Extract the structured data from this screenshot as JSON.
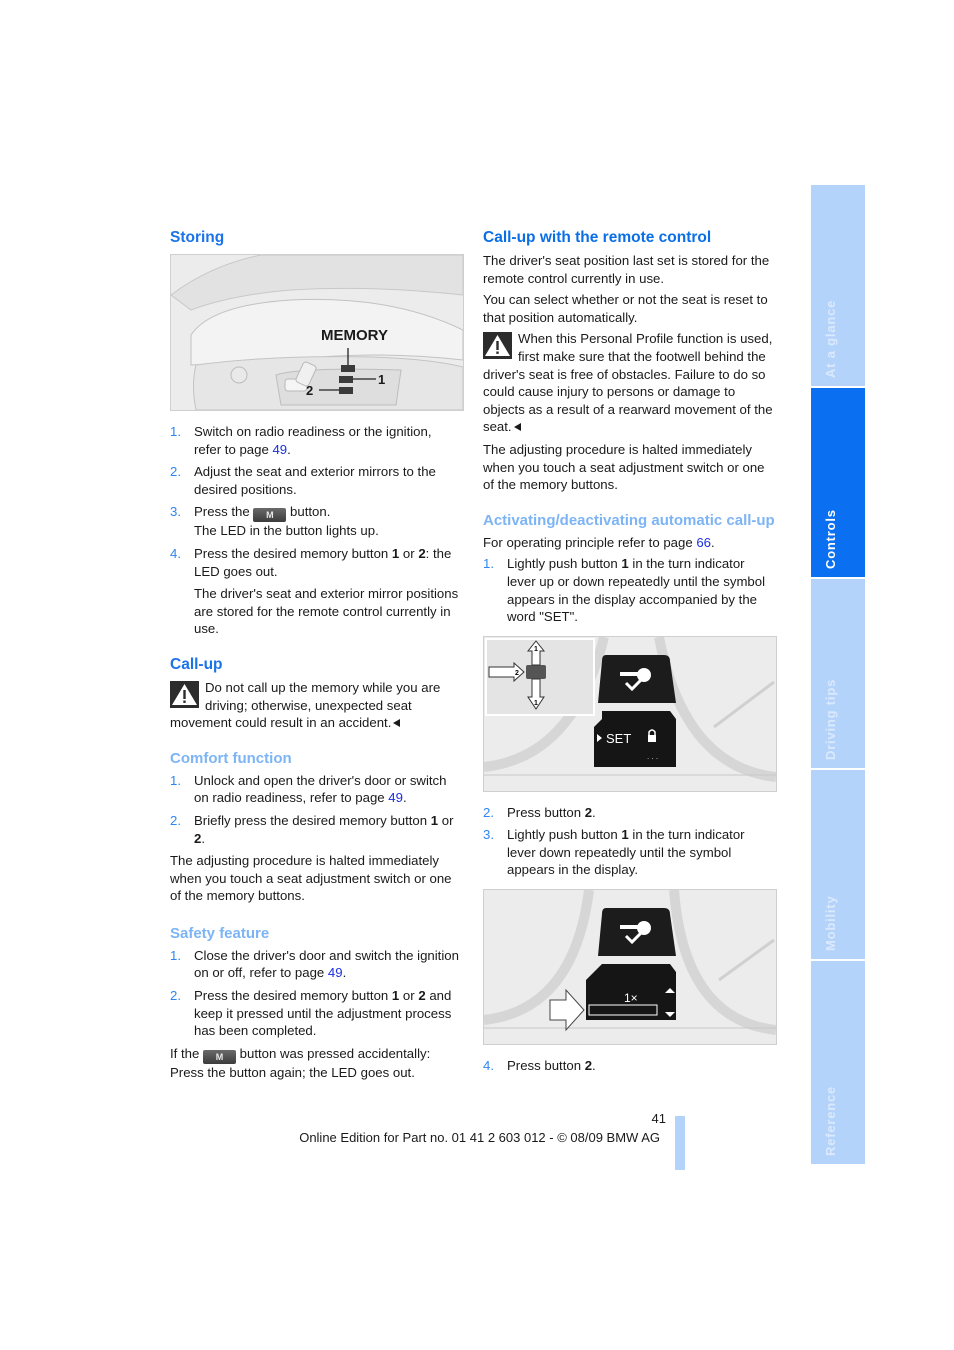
{
  "left": {
    "storing": {
      "heading": "Storing",
      "figure": {
        "label": "MEMORY",
        "callout1": "1",
        "callout2": "2"
      },
      "steps": [
        {
          "num": "1.",
          "pre": "Switch on radio readiness or the ignition, refer to page ",
          "link": "49",
          "post": "."
        },
        {
          "num": "2.",
          "text": "Adjust the seat and exterior mirrors to the desired positions."
        },
        {
          "num": "3.",
          "pre": "Press the ",
          "button": "M",
          "post": " button.",
          "line2": "The LED in the button lights up."
        },
        {
          "num": "4.",
          "pre": "Press the desired memory button ",
          "b1": "1",
          "mid": " or ",
          "b2": "2",
          "post": ": the LED goes out."
        }
      ],
      "note": "The driver's seat and exterior mirror positions are stored for the remote control currently in use."
    },
    "callup": {
      "heading": "Call-up",
      "warning": "Do not call up the memory while you are driving; otherwise, unexpected seat movement could result in an accident."
    },
    "comfort": {
      "heading": "Comfort function",
      "steps": [
        {
          "num": "1.",
          "pre": "Unlock and open the driver's door or switch on radio readiness, refer to page ",
          "link": "49",
          "post": "."
        },
        {
          "num": "2.",
          "pre": "Briefly press the desired memory button ",
          "b1": "1",
          "mid": " or ",
          "b2": "2",
          "post": "."
        }
      ],
      "note": "The adjusting procedure is halted immediately when you touch a seat adjustment switch or one of the memory buttons."
    },
    "safety": {
      "heading": "Safety feature",
      "steps": [
        {
          "num": "1.",
          "pre": "Close the driver's door and switch the ignition on or off, refer to page ",
          "link": "49",
          "post": "."
        },
        {
          "num": "2.",
          "pre": "Press the desired memory button ",
          "b1": "1",
          "mid": " or ",
          "b2": "2",
          "post": " and keep it pressed until the adjustment process has been completed."
        }
      ],
      "note_pre": "If the ",
      "note_button": "M",
      "note_post": " button was pressed accidentally: Press the button again; the LED goes out."
    }
  },
  "right": {
    "remote": {
      "heading": "Call-up with the remote control",
      "p1": "The driver's seat position last set is stored for the remote control currently in use.",
      "p2": "You can select whether or not the seat is reset to that position automatically.",
      "warning": "When this Personal Profile function is used, first make sure that the footwell behind the driver's seat is free of obstacles. Failure to do so could cause injury to persons or damage to objects as a result of a rearward movement of the seat.",
      "note": "The adjusting procedure is halted immediately when you touch a seat adjustment switch or one of the memory buttons."
    },
    "auto": {
      "heading": "Activating/deactivating automatic call-up",
      "intro_pre": "For operating principle refer to page ",
      "intro_link": "66",
      "intro_post": ".",
      "step1": {
        "num": "1.",
        "pre": "Lightly push button ",
        "b1": "1",
        "post": " in the turn indicator lever up or down repeatedly until the symbol appears in the display accompanied by the word \"SET\"."
      },
      "figure1": {
        "display_text": "SET",
        "arrow_up": "1",
        "arrow_down": "1",
        "arrow_side": "2"
      },
      "step2": {
        "num": "2.",
        "pre": "Press button ",
        "b1": "2",
        "post": "."
      },
      "step3": {
        "num": "3.",
        "pre": "Lightly push button ",
        "b1": "1",
        "post": " in the turn indicator lever down repeatedly until the symbol appears in the display."
      },
      "figure2": {
        "display_text": "1×"
      },
      "step4": {
        "num": "4.",
        "pre": "Press button ",
        "b1": "2",
        "post": "."
      }
    }
  },
  "sidetabs": [
    {
      "label": "At a glance",
      "active": false
    },
    {
      "label": "Controls",
      "active": true
    },
    {
      "label": "Driving tips",
      "active": false
    },
    {
      "label": "Mobility",
      "active": false
    },
    {
      "label": "Reference",
      "active": false
    }
  ],
  "footer": {
    "page_number": "41",
    "text": "Online Edition for Part no. 01 41 2 603 012 - © 08/09 BMW AG"
  },
  "colors": {
    "heading_blue": "#1a73e8",
    "subheading_blue": "#7db4f5",
    "link_blue": "#1a2fe0",
    "tab_inactive": "#b3d3fb",
    "tab_active": "#0a6ff0"
  }
}
